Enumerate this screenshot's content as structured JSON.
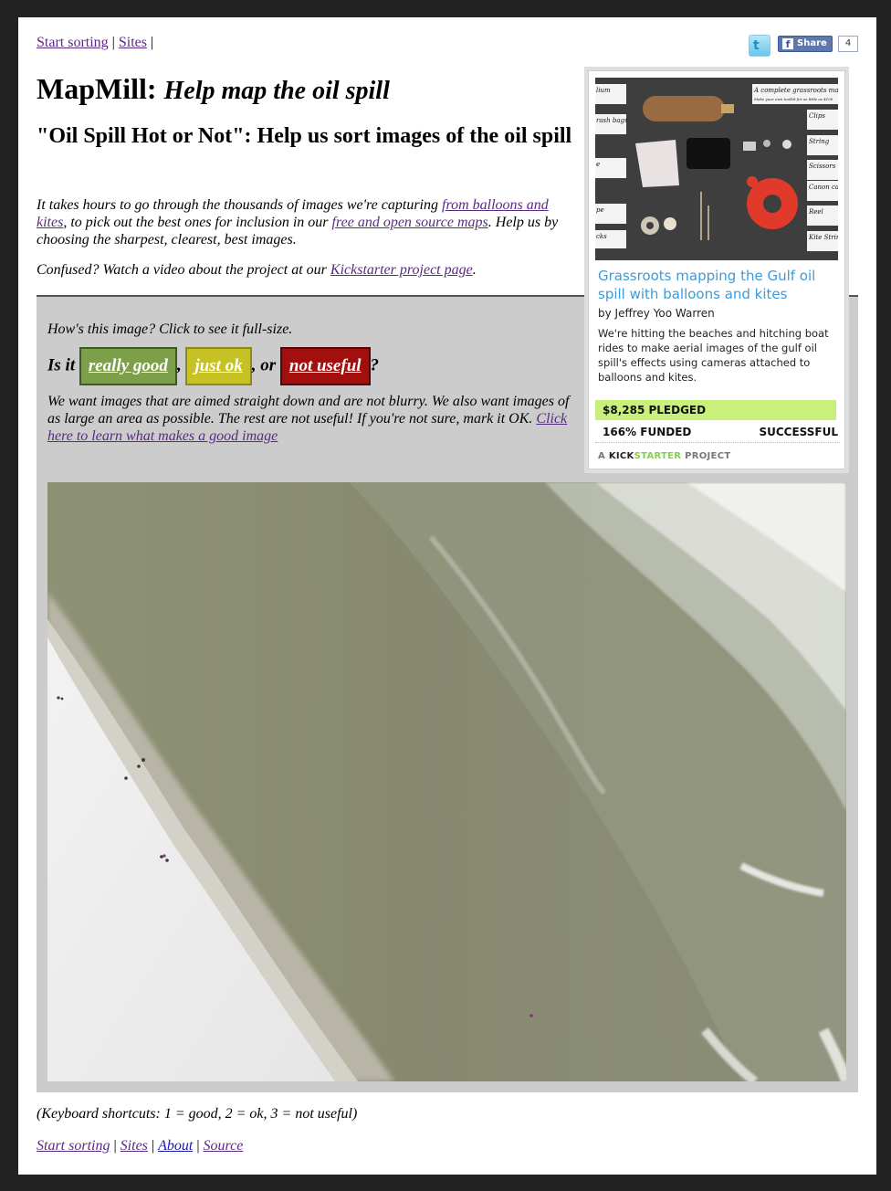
{
  "nav": {
    "start_sorting": "Start sorting",
    "sites": "Sites",
    "sep": "|"
  },
  "social": {
    "twitter_icon": "twitter-bird-icon",
    "facebook_share": "Share",
    "facebook_count": "4"
  },
  "header": {
    "title": "MapMill:",
    "tagline": "Help map the oil spill",
    "subtitle": "\"Oil Spill Hot or Not\": Help us sort images of the oil spill"
  },
  "intro": {
    "part1": "It takes hours to go through the thousands of images we're capturing ",
    "link1": "from balloons and kites",
    "part2": ", to pick out the best ones for inclusion in our ",
    "link2": "free and open source maps",
    "part3": ". Help us by choosing the sharpest, clearest, best images."
  },
  "confused": {
    "text": "Confused? Watch a video about the project at our ",
    "link": "Kickstarter project page",
    "end": "."
  },
  "rating": {
    "question": "How's this image? Click to see it full-size.",
    "is_it": "Is it",
    "comma": ",",
    "or": ", or",
    "qmark": "?",
    "good": "really good",
    "ok": "just ok",
    "bad": "not useful"
  },
  "guidance": {
    "text": "We want images that are aimed straight down and are not blurry. We also want images of as large an area as possible. The rest are not useful! If you're not sure, mark it OK. ",
    "link": "Click here to learn what makes a good image"
  },
  "kickstarter": {
    "title": "Grassroots mapping the Gulf oil spill with balloons and kites",
    "by": "by Jeffrey Yoo Warren",
    "blurb": "We're hitting the beaches and hitching boat rides to make aerial images of the gulf oil spill's effects using cameras attached to balloons and kites.",
    "pledged": "$8,285 PLEDGED",
    "funded": "166% FUNDED",
    "status": "SUCCESSFUL",
    "brand_prefix": "A",
    "brand_logo_a": "KICK",
    "brand_logo_b": "STARTER",
    "brand_suffix": "PROJECT",
    "image_labels": {
      "header": "A complete grassroots mapping",
      "header_sub": "Make your own toolkit for as little as $100",
      "left": [
        "lium",
        "rash bags",
        "e",
        "pe",
        "cks"
      ],
      "right": [
        "Clips",
        "String",
        "Scissors",
        "Canon cam",
        "Reel",
        "Kite String"
      ]
    }
  },
  "footer": {
    "shortcuts": "(Keyboard shortcuts: 1 = good, 2 = ok, 3 = not useful)",
    "start_sorting": "Start sorting",
    "sites": "Sites",
    "about": "About",
    "source": "Source",
    "sep": "|"
  }
}
